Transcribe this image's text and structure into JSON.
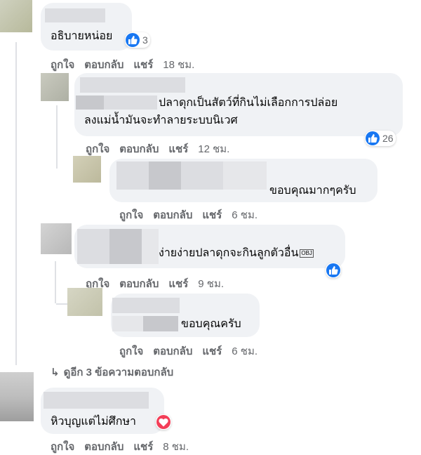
{
  "comments": [
    {
      "text": "อธิบายหน่อย",
      "reaction_count": "3",
      "actions": {
        "like": "ถูกใจ",
        "reply": "ตอบกลับ",
        "share": "แชร์",
        "time": "18 ชม."
      }
    },
    {
      "text_line1": "ปลาดุกเป็นสัตว์ที่กินไม่เลือกการปล่อย",
      "text_line2": "ลงแม่น้ำมันจะทำลายระบบนิเวศ",
      "reaction_count": "26",
      "actions": {
        "like": "ถูกใจ",
        "reply": "ตอบกลับ",
        "share": "แชร์",
        "time": "12 ชม."
      }
    },
    {
      "text": "ขอบคุณมากๆครับ",
      "actions": {
        "like": "ถูกใจ",
        "reply": "ตอบกลับ",
        "share": "แชร์",
        "time": "6 ชม."
      }
    },
    {
      "text": "ง่ายง่ายปลาดุกจะกินลูกตัวอื่น",
      "emoji_label": "OBJ",
      "actions": {
        "like": "ถูกใจ",
        "reply": "ตอบกลับ",
        "share": "แชร์",
        "time": "9 ชม."
      }
    },
    {
      "text": "ขอบคุณครับ",
      "actions": {
        "like": "ถูกใจ",
        "reply": "ตอบกลับ",
        "share": "แชร์",
        "time": "6 ชม."
      }
    },
    {
      "text": "หิวบุญแต่ไม่ศึกษา",
      "actions": {
        "like": "ถูกใจ",
        "reply": "ตอบกลับ",
        "share": "แชร์",
        "time": "8 ชม."
      }
    }
  ],
  "view_more_replies": "ดูอีก 3 ข้อความตอบกลับ",
  "colors": {
    "like": "#1877f2",
    "love": "#f33e58",
    "bubble": "#f0f2f5",
    "meta": "#65676b"
  },
  "icons": [
    "like-icon",
    "love-icon",
    "reply-arrow-icon"
  ]
}
